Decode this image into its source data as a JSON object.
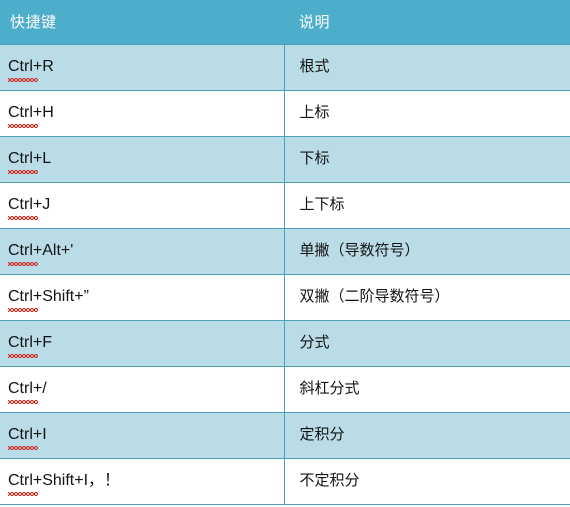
{
  "table": {
    "columns": [
      {
        "key": "shortcut",
        "label": "快捷键"
      },
      {
        "key": "description",
        "label": "说明"
      }
    ],
    "header_background": "#4CAECA",
    "header_text_color": "#FFFFFF",
    "shaded_row_background": "#B9DCE7",
    "plain_row_background": "#FFFFFF",
    "border_color": "#4E9FBC",
    "spellcheck_underline_color": "#D42A20",
    "rows": [
      {
        "shortcut": "Ctrl+R",
        "description": "根式"
      },
      {
        "shortcut": "Ctrl+H",
        "description": "上标"
      },
      {
        "shortcut": "Ctrl+L",
        "description": "下标"
      },
      {
        "shortcut": "Ctrl+J",
        "description": "上下标"
      },
      {
        "shortcut": "Ctrl+Alt+'",
        "description": "单撇（导数符号）"
      },
      {
        "shortcut": "Ctrl+Shift+”",
        "description": "双撇（二阶导数符号）"
      },
      {
        "shortcut": "Ctrl+F",
        "description": "分式"
      },
      {
        "shortcut": "Ctrl+/",
        "description": "斜杠分式"
      },
      {
        "shortcut": "Ctrl+I",
        "description": "定积分"
      },
      {
        "shortcut": "Ctrl+Shift+I，！",
        "description": "不定积分"
      }
    ]
  }
}
